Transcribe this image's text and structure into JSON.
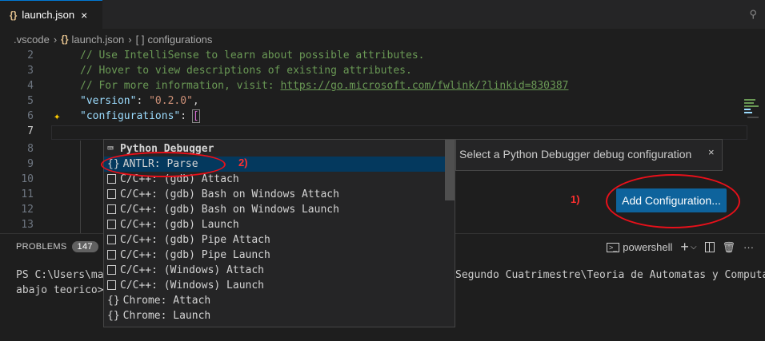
{
  "tab": {
    "icon": "{}",
    "title": "launch.json",
    "close": "×"
  },
  "pin_icon": "pin-icon",
  "breadcrumb": [
    ".vscode",
    "launch.json",
    "configurations"
  ],
  "breadcrumb_icons": {
    "json": "{}",
    "array": "[ ]"
  },
  "editor": {
    "lines": [
      {
        "n": "2",
        "text": "// Use IntelliSense to learn about possible attributes."
      },
      {
        "n": "3",
        "text": "// Hover to view descriptions of existing attributes."
      },
      {
        "n": "4",
        "pre": "// For more information, visit: ",
        "link": "https://go.microsoft.com/fwlink/?linkid=830387"
      },
      {
        "n": "5",
        "key": "\"version\"",
        "colon": ": ",
        "val": "\"0.2.0\"",
        "tail": ","
      },
      {
        "n": "6",
        "key": "\"configurations\"",
        "colon": ": ",
        "bracket": "["
      },
      {
        "n": "7"
      },
      {
        "n": "8"
      },
      {
        "n": "9"
      },
      {
        "n": "10"
      },
      {
        "n": "11"
      },
      {
        "n": "12"
      },
      {
        "n": "13"
      }
    ]
  },
  "suggest": {
    "items": [
      {
        "icon": "python-debugger-icon",
        "label": "Python Debugger"
      },
      {
        "icon": "{}",
        "label": "ANTLR: Parse"
      },
      {
        "icon": "box",
        "label": "C/C++: (gdb) Attach"
      },
      {
        "icon": "box",
        "label": "C/C++: (gdb) Bash on Windows Attach"
      },
      {
        "icon": "box",
        "label": "C/C++: (gdb) Bash on Windows Launch"
      },
      {
        "icon": "box",
        "label": "C/C++: (gdb) Launch"
      },
      {
        "icon": "box",
        "label": "C/C++: (gdb) Pipe Attach"
      },
      {
        "icon": "box",
        "label": "C/C++: (gdb) Pipe Launch"
      },
      {
        "icon": "box",
        "label": "C/C++: (Windows) Attach"
      },
      {
        "icon": "box",
        "label": "C/C++: (Windows) Launch"
      },
      {
        "icon": "{}",
        "label": "Chrome: Attach"
      },
      {
        "icon": "{}",
        "label": "Chrome: Launch"
      }
    ],
    "detail": "Select a Python Debugger debug configuration",
    "detail_close": "×"
  },
  "add_configuration": "Add Configuration...",
  "annotations": {
    "one": "1)",
    "two": "2)"
  },
  "panel": {
    "problems_label": "PROBLEMS",
    "problems_count": "147",
    "shell": "powershell",
    "terminal_line1_left": "PS C:\\Users\\man",
    "terminal_line1_right": "Segundo Cuatrimestre\\Teoria de Automatas y Computaci",
    "terminal_line2": "abajo teorico>"
  },
  "colors": {
    "accent": "#0078d4",
    "button": "#0e639c",
    "annotation": "#e8101a"
  }
}
